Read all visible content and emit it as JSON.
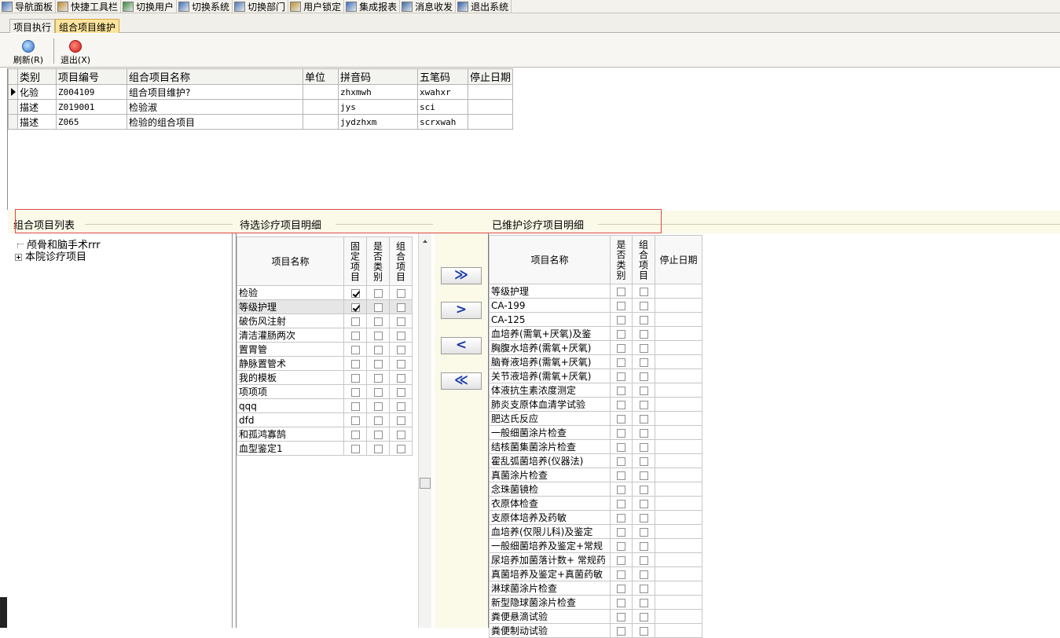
{
  "menubar": {
    "items": [
      {
        "label": "导航面板",
        "icon": "navigation-panel-icon"
      },
      {
        "label": "快捷工具栏",
        "icon": "toolbar-icon"
      },
      {
        "label": "切换用户",
        "icon": "switch-user-icon"
      },
      {
        "label": "切换系统",
        "icon": "switch-system-icon"
      },
      {
        "label": "切换部门",
        "icon": "switch-department-icon"
      },
      {
        "label": "用户锁定",
        "icon": "lock-user-icon"
      },
      {
        "label": "集成报表",
        "icon": "report-icon"
      },
      {
        "label": "消息收发",
        "icon": "message-icon"
      },
      {
        "label": "退出系统",
        "icon": "exit-system-icon"
      }
    ]
  },
  "tabs": [
    {
      "label": "项目执行"
    },
    {
      "label": "组合项目维护"
    }
  ],
  "toolbar": {
    "refresh_label": "刷新(R)",
    "exit_label": "退出(X)"
  },
  "top_grid": {
    "headers": [
      "类别",
      "项目编号",
      "组合项目名称",
      "单位",
      "拼音码",
      "五笔码",
      "停止日期"
    ],
    "rows": [
      [
        "化验",
        "Z004109",
        "组合项目维护?",
        "",
        "zhxmwh",
        "xwahxr",
        ""
      ],
      [
        "描述",
        "Z019001",
        "检验淑",
        "",
        "jys",
        "sci",
        ""
      ],
      [
        "描述",
        "Z065",
        "检验的组合项目",
        "",
        "jydzhxm",
        "scrxwah",
        ""
      ]
    ]
  },
  "sections": {
    "tree_title": "组合项目列表",
    "candidate_title": "待选诊疗项目明细",
    "done_title": "已维护诊疗项目明细"
  },
  "tree": {
    "nodes": [
      "颅骨和脑手术rrr",
      "本院诊疗项目"
    ]
  },
  "candidate_table": {
    "headers": {
      "name": "项目名称",
      "fixed": "固定项目",
      "category": "是否类别",
      "combo": "组合项目"
    },
    "rows": [
      {
        "name": "检验",
        "fixed": true,
        "category": false,
        "combo": false
      },
      {
        "name": "等级护理",
        "fixed": true,
        "category": false,
        "combo": false
      },
      {
        "name": "破伤风注射",
        "fixed": false,
        "category": false,
        "combo": false
      },
      {
        "name": "清洁灌肠两次",
        "fixed": false,
        "category": false,
        "combo": false
      },
      {
        "name": "置胃管",
        "fixed": false,
        "category": false,
        "combo": false
      },
      {
        "name": "静脉置管术",
        "fixed": false,
        "category": false,
        "combo": false
      },
      {
        "name": "我的模板",
        "fixed": false,
        "category": false,
        "combo": false
      },
      {
        "name": "项项项",
        "fixed": false,
        "category": false,
        "combo": false
      },
      {
        "name": "qqq",
        "fixed": false,
        "category": false,
        "combo": false
      },
      {
        "name": "dfd",
        "fixed": false,
        "category": false,
        "combo": false
      },
      {
        "name": "和孤鸿寡鹄",
        "fixed": false,
        "category": false,
        "combo": false
      },
      {
        "name": "血型鉴定1",
        "fixed": false,
        "category": false,
        "combo": false
      }
    ]
  },
  "move_buttons": {
    "add_all": "≫",
    "add_one": ">",
    "remove_one": "<",
    "remove_all": "≪"
  },
  "done_table": {
    "headers": {
      "name": "项目名称",
      "category": "是否类别",
      "combo": "组合项目",
      "stop_date": "停止日期"
    },
    "rows": [
      "等级护理",
      "CA-199",
      "CA-125",
      "血培养(需氧+厌氧)及鉴",
      "胸腹水培养(需氧+厌氧)",
      "脑脊液培养(需氧+厌氧)",
      "关节液培养(需氧+厌氧)",
      "体液抗生素浓度测定",
      "肺炎支原体血清学试验",
      "肥达氏反应",
      "一般细菌涂片检查",
      "结核菌集菌涂片检查",
      "霍乱弧菌培养(仪器法)",
      "真菌涂片检查",
      "念珠菌镜检",
      "衣原体检查",
      "支原体培养及药敏",
      "血培养(仅限儿科)及鉴定",
      "一般细菌培养及鉴定+常规",
      "尿培养加菌落计数+ 常规药",
      "真菌培养及鉴定+真菌药敏",
      "淋球菌涂片检查",
      "新型隐球菌涂片检查",
      "粪便悬滴试验",
      "粪便制动试验"
    ]
  }
}
